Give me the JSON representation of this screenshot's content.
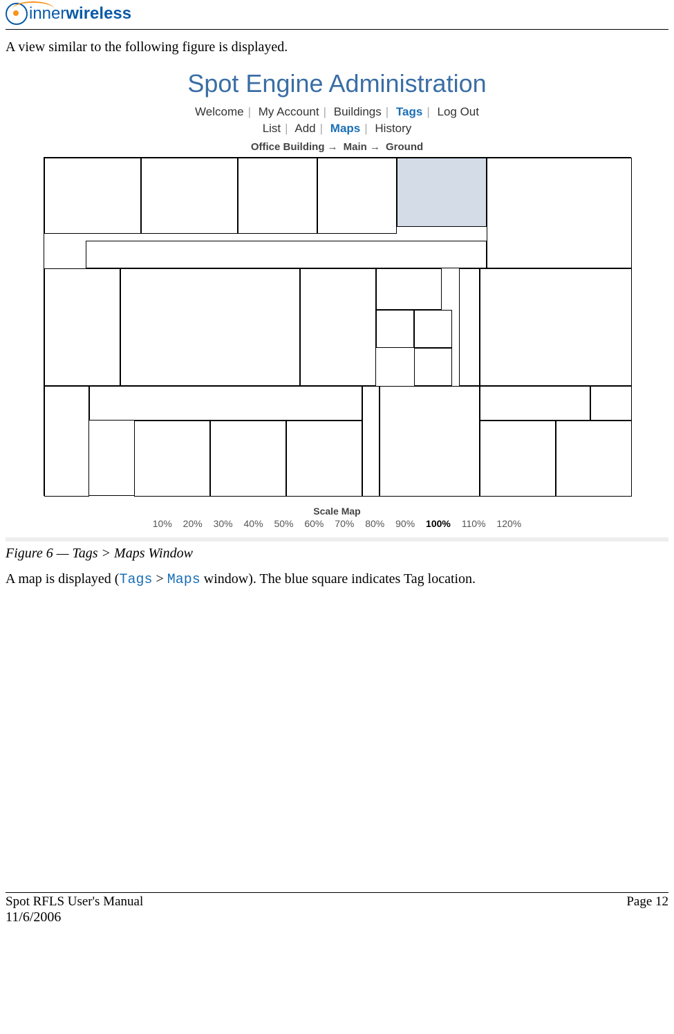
{
  "logo": {
    "part1": "inner",
    "part2": "wireless"
  },
  "intro_text": "A view similar to the following figure is displayed.",
  "app_title": "Spot Engine Administration",
  "nav_primary": [
    "Welcome",
    "My Account",
    "Buildings",
    "Tags",
    "Log Out"
  ],
  "nav_primary_active": "Tags",
  "nav_secondary": [
    "List",
    "Add",
    "Maps",
    "History"
  ],
  "nav_secondary_active": "Maps",
  "breadcrumb": [
    "Office Building",
    "Main",
    "Ground"
  ],
  "scale_label": "Scale Map",
  "scale_options": [
    "10%",
    "20%",
    "30%",
    "40%",
    "50%",
    "60%",
    "70%",
    "80%",
    "90%",
    "100%",
    "110%",
    "120%"
  ],
  "scale_active": "100%",
  "figure_caption": "Figure 6 — Tags > Maps Window",
  "body_sentence": {
    "pre": "A map is displayed (",
    "code1": "Tags",
    "mid": " > ",
    "code2": "Maps",
    "post": " window). The blue square indicates Tag location."
  },
  "footer": {
    "manual": "Spot RFLS User's Manual",
    "page": "Page 12",
    "date": "11/6/2006"
  }
}
